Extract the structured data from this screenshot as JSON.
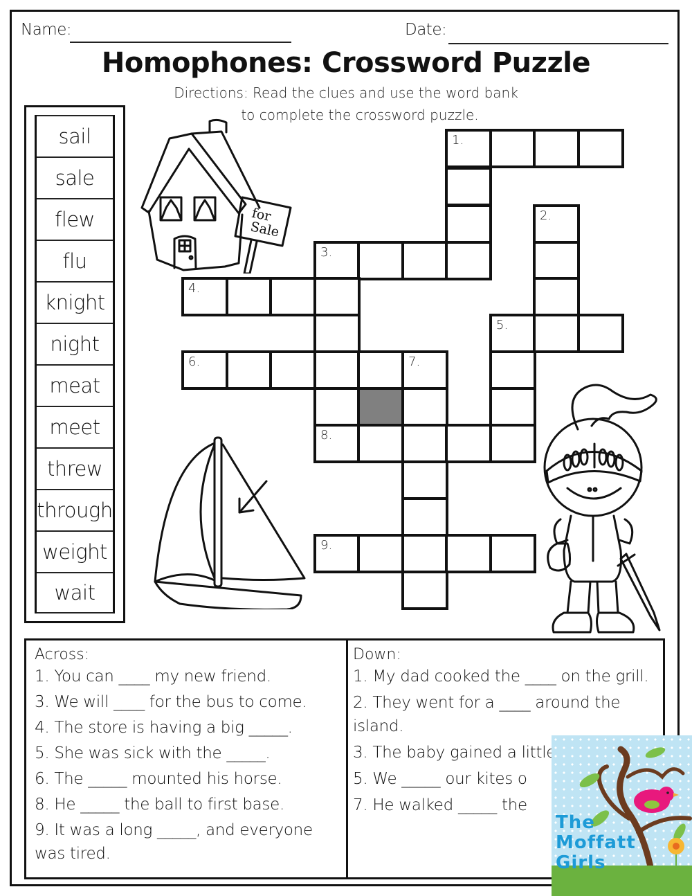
{
  "header": {
    "name_label": "Name:",
    "date_label": "Date:",
    "title": "Homophones: Crossword Puzzle",
    "directions_line1": "Directions: Read the clues and use the word bank",
    "directions_line2": "to complete the crossword puzzle."
  },
  "word_bank": [
    "sail",
    "sale",
    "flew",
    "flu",
    "knight",
    "night",
    "meat",
    "meet",
    "threw",
    "through",
    "weight",
    "wait"
  ],
  "crossword": {
    "numbers": [
      "1.",
      "2.",
      "3.",
      "4.",
      "5.",
      "6.",
      "7.",
      "8.",
      "9."
    ],
    "cells": [
      {
        "r": 0,
        "c": 6,
        "n": "1."
      },
      {
        "r": 0,
        "c": 7
      },
      {
        "r": 0,
        "c": 8
      },
      {
        "r": 0,
        "c": 9
      },
      {
        "r": 1,
        "c": 6
      },
      {
        "r": 2,
        "c": 6
      },
      {
        "r": 2,
        "c": 8,
        "n": "2."
      },
      {
        "r": 3,
        "c": 3,
        "n": "3."
      },
      {
        "r": 3,
        "c": 4
      },
      {
        "r": 3,
        "c": 5
      },
      {
        "r": 3,
        "c": 6
      },
      {
        "r": 3,
        "c": 8
      },
      {
        "r": 4,
        "c": 0,
        "n": "4."
      },
      {
        "r": 4,
        "c": 1
      },
      {
        "r": 4,
        "c": 2
      },
      {
        "r": 4,
        "c": 3
      },
      {
        "r": 4,
        "c": 8
      },
      {
        "r": 5,
        "c": 3
      },
      {
        "r": 5,
        "c": 7,
        "n": "5."
      },
      {
        "r": 5,
        "c": 8
      },
      {
        "r": 5,
        "c": 9
      },
      {
        "r": 6,
        "c": 0,
        "n": "6."
      },
      {
        "r": 6,
        "c": 1
      },
      {
        "r": 6,
        "c": 2
      },
      {
        "r": 6,
        "c": 3
      },
      {
        "r": 6,
        "c": 4
      },
      {
        "r": 6,
        "c": 5,
        "n": "7."
      },
      {
        "r": 6,
        "c": 7
      },
      {
        "r": 7,
        "c": 3
      },
      {
        "r": 7,
        "c": 4,
        "blocked": true
      },
      {
        "r": 7,
        "c": 5
      },
      {
        "r": 7,
        "c": 7
      },
      {
        "r": 8,
        "c": 3,
        "n": "8."
      },
      {
        "r": 8,
        "c": 4
      },
      {
        "r": 8,
        "c": 5
      },
      {
        "r": 8,
        "c": 6
      },
      {
        "r": 8,
        "c": 7
      },
      {
        "r": 9,
        "c": 5
      },
      {
        "r": 10,
        "c": 5
      },
      {
        "r": 11,
        "c": 3,
        "n": "9."
      },
      {
        "r": 11,
        "c": 4
      },
      {
        "r": 11,
        "c": 5
      },
      {
        "r": 11,
        "c": 6
      },
      {
        "r": 11,
        "c": 7
      },
      {
        "r": 12,
        "c": 5
      }
    ],
    "blocked_color": "#808080"
  },
  "illustrations": {
    "house_sign_line1": "for",
    "house_sign_line2": "Sale"
  },
  "clues": {
    "across_heading": "Across:",
    "across": [
      "1. You can ____ my new friend.",
      "3. We will ____ for the bus to come.",
      "4. The store is having a big _____.",
      "5. She was sick with the _____.",
      "6. The _____ mounted his horse.",
      "8. He _____ the ball to first base.",
      "9. It was a long  _____,  and everyone was tired."
    ],
    "down_heading": "Down:",
    "down": [
      "1. My dad cooked the ____ on the grill.",
      "2. They went for a ____ around the island.",
      "3. The baby gained a little",
      "5. We _____ our kites o",
      "7. He walked  _____ the"
    ]
  },
  "logo": {
    "line1": "The",
    "line2": "Moffatt",
    "line3": "Girls",
    "text_color": "#1d9bd7",
    "bg_color": "#bfe4f4",
    "grass_color": "#6bb23f",
    "bird_color": "#e8197d"
  }
}
